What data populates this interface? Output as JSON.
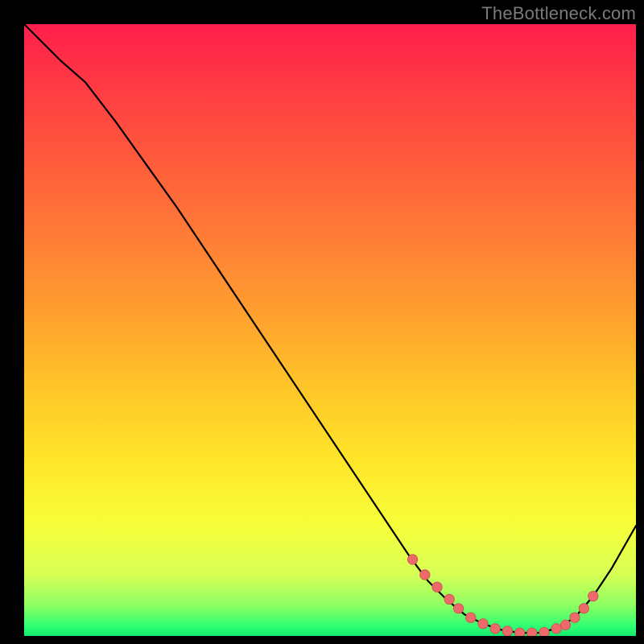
{
  "attribution": "TheBottleneck.com",
  "colors": {
    "bg": "#000000",
    "gradient_stops": [
      {
        "offset": 0.0,
        "color": "#ff1e4a"
      },
      {
        "offset": 0.1,
        "color": "#ff3a44"
      },
      {
        "offset": 0.22,
        "color": "#ff5a3c"
      },
      {
        "offset": 0.35,
        "color": "#ff7d36"
      },
      {
        "offset": 0.48,
        "color": "#ffa22e"
      },
      {
        "offset": 0.6,
        "color": "#ffc728"
      },
      {
        "offset": 0.72,
        "color": "#ffe72a"
      },
      {
        "offset": 0.82,
        "color": "#f7ff3a"
      },
      {
        "offset": 0.9,
        "color": "#d6ff55"
      },
      {
        "offset": 0.95,
        "color": "#8cff63"
      },
      {
        "offset": 0.985,
        "color": "#2dff73"
      },
      {
        "offset": 1.0,
        "color": "#14e86f"
      }
    ],
    "curve": "#000000",
    "dot_fill": "#ec6a6a",
    "dot_stroke": "#c94f4f"
  },
  "chart_data": {
    "type": "line",
    "title": "",
    "xlabel": "",
    "ylabel": "",
    "xlim": [
      0,
      100
    ],
    "ylim": [
      0,
      100
    ],
    "series": [
      {
        "name": "bottleneck-curve",
        "x": [
          0,
          3,
          6,
          10,
          15,
          20,
          25,
          30,
          35,
          40,
          45,
          50,
          55,
          60,
          63,
          66,
          69,
          72,
          75,
          78,
          81,
          84,
          87,
          90,
          93,
          96,
          100
        ],
        "y": [
          100,
          97,
          94,
          90.5,
          84,
          77,
          70,
          62.5,
          55,
          47.5,
          40,
          32.5,
          25,
          17.5,
          13,
          9,
          6,
          3.5,
          2,
          1,
          0.5,
          0.5,
          1.2,
          3,
          6.5,
          11,
          18
        ]
      }
    ],
    "markers": {
      "name": "highlighted-points",
      "x": [
        63.5,
        65.5,
        67.5,
        69.5,
        71,
        73,
        75,
        77,
        79,
        81,
        83,
        85,
        87,
        88.5,
        90,
        91.5,
        93
      ],
      "y": [
        12.5,
        10,
        8,
        6,
        4.5,
        3,
        2,
        1.2,
        0.8,
        0.5,
        0.5,
        0.6,
        1.2,
        1.8,
        3,
        4.5,
        6.5
      ]
    }
  }
}
